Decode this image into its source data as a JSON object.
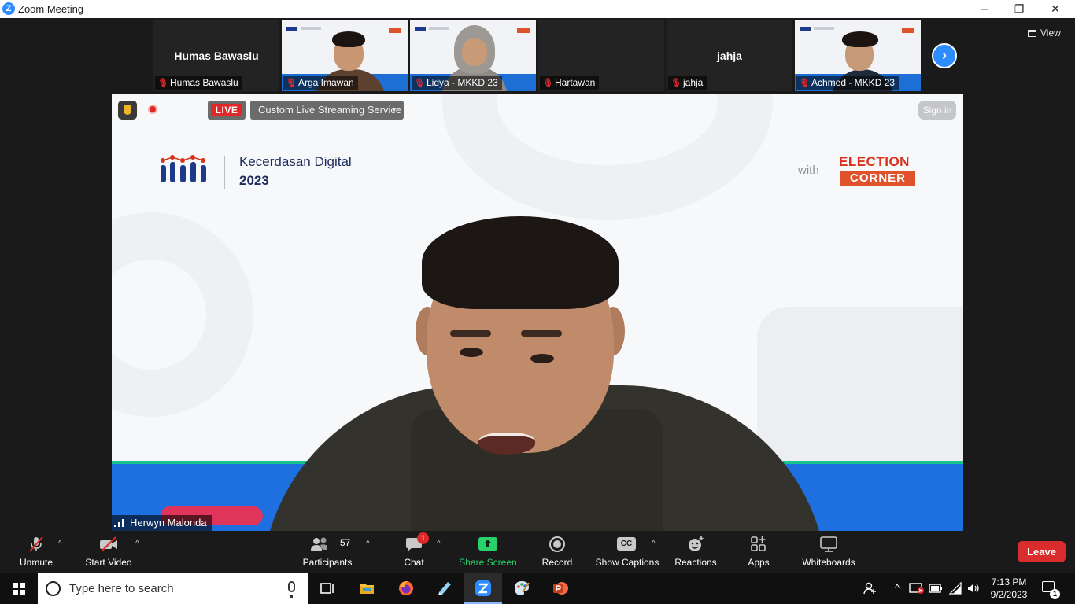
{
  "window": {
    "title": "Zoom Meeting",
    "logo_letter": "Z",
    "minimize_glyph": "─",
    "restore_glyph": "❐",
    "close_glyph": "✕"
  },
  "strip": {
    "tiles": [
      {
        "name": "Humas Bawaslu",
        "center_name": "Humas Bawaslu",
        "muted": true,
        "has_video": false
      },
      {
        "name": "Arga Imawan",
        "muted": true,
        "has_video": true
      },
      {
        "name": "Lidya - MKKD 23",
        "muted": true,
        "has_video": true
      },
      {
        "name": "Hartawan",
        "muted": true,
        "has_video": false
      },
      {
        "name": "jahja",
        "center_name": "jahja",
        "muted": true,
        "has_video": false
      },
      {
        "name": "Achmed - MKKD 23",
        "muted": true,
        "has_video": true
      }
    ],
    "next_glyph": "›",
    "view_label": "View"
  },
  "main": {
    "live_label": "LIVE",
    "stream_service": "Custom Live Streaming Service",
    "signin_label": "Sign in",
    "slide": {
      "brand_title": "Kecerdasan Digital",
      "brand_year": "2023",
      "with": "with",
      "election_top": "ELECTION",
      "election_bottom": "CORNER"
    },
    "speaker_name": "Herwyn Malonda"
  },
  "toolbar": {
    "unmute_label": "Unmute",
    "start_video_label": "Start Video",
    "participants_label": "Participants",
    "participants_count": "57",
    "chat_label": "Chat",
    "chat_badge": "1",
    "share_label": "Share Screen",
    "record_label": "Record",
    "captions_label": "Show Captions",
    "captions_glyph": "CC",
    "reactions_label": "Reactions",
    "apps_label": "Apps",
    "whiteboards_label": "Whiteboards",
    "leave_label": "Leave",
    "caret_glyph": "^",
    "share_color": "#2bd16a",
    "leave_color": "#d92d2d"
  },
  "taskbar": {
    "search_placeholder": "Type here to search",
    "time": "7:13 PM",
    "date": "9/2/2023",
    "notification_count": "1",
    "chevron_glyph": "^"
  }
}
